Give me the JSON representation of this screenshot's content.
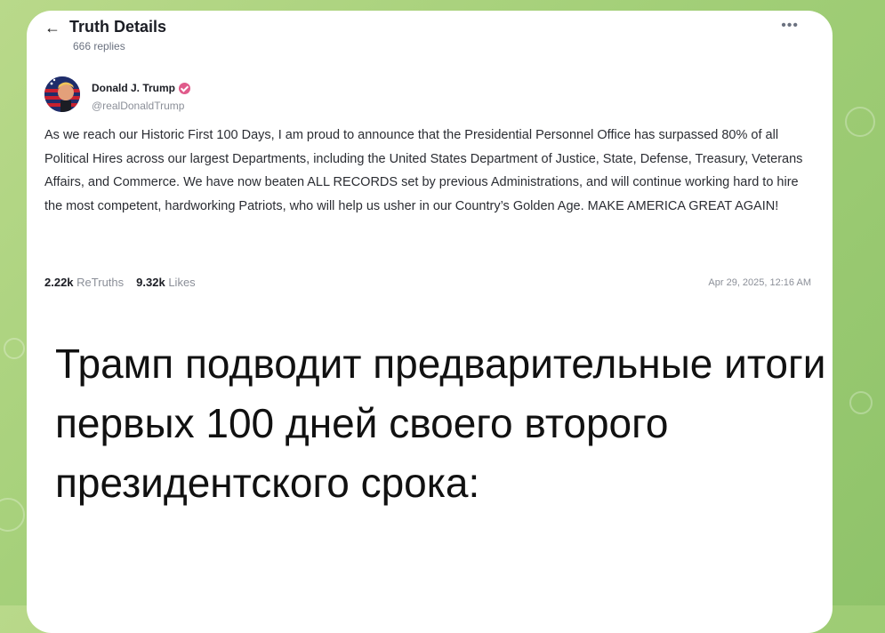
{
  "colors": {
    "background": "#a3cf78",
    "card": "#ffffff",
    "verified_badge": "#e05b8b",
    "muted_text": "#8b8f98"
  },
  "post_view": {
    "back_icon": "arrow-left-icon",
    "title": "Truth Details",
    "replies": "666 replies",
    "more_icon": "more-dots-icon",
    "author": {
      "name": "Donald J. Trump",
      "handle": "@realDonaldTrump",
      "verified_icon": "verified-badge-icon"
    },
    "body": "As we reach our Historic First 100 Days, I am proud to announce that the Presidential Personnel Office has surpassed 80% of all Political Hires across our largest Departments, including the United States Department of Justice, State, Defense, Treasury, Veterans Affairs, and Commerce. We have now beaten ALL RECORDS set by previous Administrations, and will continue working hard to hire the most competent, hardworking Patriots, who will help us usher in our Country’s Golden Age. MAKE AMERICA GREAT AGAIN!",
    "retruths_count": "2.22k",
    "retruths_label": "ReTruths",
    "likes_count": "9.32k",
    "likes_label": "Likes",
    "timestamp": "Apr 29, 2025, 12:16 AM"
  },
  "caption": "Трамп подводит предварительные итоги первых 100 дней своего второго президентского срока:"
}
